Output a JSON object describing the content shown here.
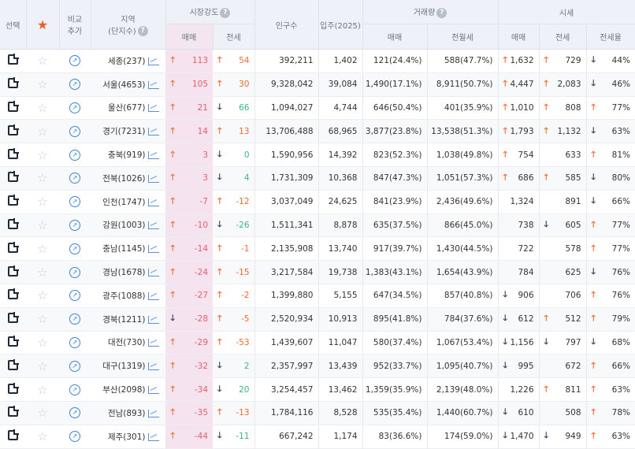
{
  "headers": {
    "select": "선택",
    "compare_line1": "비교",
    "compare_line2": "추가",
    "region_line1": "지역",
    "region_line2": "(단지수)",
    "market_strength": "시장강도",
    "population": "인구수",
    "move_in": "입주(2025)",
    "trade_volume": "거래량",
    "price": "시세",
    "sale": "매매",
    "jeonse": "전세",
    "sale2": "매매",
    "jeonse_monthly": "전월세",
    "sale3": "매매",
    "jeonse3": "전세",
    "jeonse_ratio": "전세율"
  },
  "colors": {
    "up": "#f36a2b",
    "down": "#2b3a55",
    "pink": "#e35d6a",
    "highlight": "#f5e4f0"
  },
  "rows": [
    {
      "region": "세종(237)",
      "ms_sale_dir": "up",
      "ms_sale": "113",
      "ms_j_dir": "up",
      "ms_j": "54",
      "pop": "392,211",
      "movein": "1,402",
      "vol_sale": "121(24.4%)",
      "vol_rent": "588(47.7%)",
      "p_sale_dir": "up",
      "p_sale": "1,632",
      "p_j_dir": "up",
      "p_j": "729",
      "ratio_dir": "down",
      "ratio": "44%"
    },
    {
      "region": "서울(4653)",
      "ms_sale_dir": "up",
      "ms_sale": "105",
      "ms_j_dir": "up",
      "ms_j": "30",
      "pop": "9,328,042",
      "movein": "39,084",
      "vol_sale": "1,490(17.1%)",
      "vol_rent": "8,911(50.7%)",
      "p_sale_dir": "up",
      "p_sale": "4,447",
      "p_j_dir": "up",
      "p_j": "2,083",
      "ratio_dir": "down",
      "ratio": "46%"
    },
    {
      "region": "울산(677)",
      "ms_sale_dir": "up",
      "ms_sale": "21",
      "ms_j_dir": "down",
      "ms_j": "66",
      "pop": "1,094,027",
      "movein": "4,744",
      "vol_sale": "646(50.4%)",
      "vol_rent": "401(35.9%)",
      "p_sale_dir": "up",
      "p_sale": "1,010",
      "p_j_dir": "up",
      "p_j": "808",
      "ratio_dir": "up",
      "ratio": "77%"
    },
    {
      "region": "경기(7231)",
      "ms_sale_dir": "up",
      "ms_sale": "14",
      "ms_j_dir": "up",
      "ms_j": "13",
      "pop": "13,706,488",
      "movein": "68,965",
      "vol_sale": "3,877(23.8%)",
      "vol_rent": "13,538(51.3%)",
      "p_sale_dir": "up",
      "p_sale": "1,793",
      "p_j_dir": "up",
      "p_j": "1,132",
      "ratio_dir": "down",
      "ratio": "63%"
    },
    {
      "region": "충북(919)",
      "ms_sale_dir": "up",
      "ms_sale": "3",
      "ms_j_dir": "down",
      "ms_j": "0",
      "pop": "1,590,956",
      "movein": "14,392",
      "vol_sale": "823(52.3%)",
      "vol_rent": "1,038(49.8%)",
      "p_sale_dir": "up",
      "p_sale": "754",
      "p_j_dir": "",
      "p_j": "633",
      "ratio_dir": "up",
      "ratio": "81%"
    },
    {
      "region": "전북(1026)",
      "ms_sale_dir": "up",
      "ms_sale": "3",
      "ms_j_dir": "down",
      "ms_j": "4",
      "pop": "1,731,309",
      "movein": "10,368",
      "vol_sale": "847(47.3%)",
      "vol_rent": "1,051(57.3%)",
      "p_sale_dir": "up",
      "p_sale": "686",
      "p_j_dir": "up",
      "p_j": "585",
      "ratio_dir": "down",
      "ratio": "80%"
    },
    {
      "region": "인천(1747)",
      "ms_sale_dir": "up",
      "ms_sale": "-7",
      "ms_j_dir": "up",
      "ms_j": "-12",
      "pop": "3,037,049",
      "movein": "24,625",
      "vol_sale": "841(23.9%)",
      "vol_rent": "2,436(49.6%)",
      "p_sale_dir": "",
      "p_sale": "1,324",
      "p_j_dir": "",
      "p_j": "891",
      "ratio_dir": "down",
      "ratio": "66%"
    },
    {
      "region": "강원(1003)",
      "ms_sale_dir": "up",
      "ms_sale": "-10",
      "ms_j_dir": "down",
      "ms_j": "-26",
      "pop": "1,511,341",
      "movein": "8,878",
      "vol_sale": "635(37.5%)",
      "vol_rent": "866(45.0%)",
      "p_sale_dir": "",
      "p_sale": "738",
      "p_j_dir": "down",
      "p_j": "605",
      "ratio_dir": "up",
      "ratio": "77%"
    },
    {
      "region": "충남(1145)",
      "ms_sale_dir": "up",
      "ms_sale": "-14",
      "ms_j_dir": "up",
      "ms_j": "-1",
      "pop": "2,135,908",
      "movein": "13,740",
      "vol_sale": "917(39.7%)",
      "vol_rent": "1,430(44.5%)",
      "p_sale_dir": "",
      "p_sale": "722",
      "p_j_dir": "",
      "p_j": "578",
      "ratio_dir": "up",
      "ratio": "77%"
    },
    {
      "region": "경남(1678)",
      "ms_sale_dir": "up",
      "ms_sale": "-24",
      "ms_j_dir": "up",
      "ms_j": "-15",
      "pop": "3,217,584",
      "movein": "19,738",
      "vol_sale": "1,383(43.1%)",
      "vol_rent": "1,654(43.9%)",
      "p_sale_dir": "",
      "p_sale": "784",
      "p_j_dir": "",
      "p_j": "625",
      "ratio_dir": "down",
      "ratio": "76%"
    },
    {
      "region": "광주(1088)",
      "ms_sale_dir": "up",
      "ms_sale": "-27",
      "ms_j_dir": "up",
      "ms_j": "-2",
      "pop": "1,399,880",
      "movein": "5,155",
      "vol_sale": "647(34.5%)",
      "vol_rent": "857(40.8%)",
      "p_sale_dir": "down",
      "p_sale": "906",
      "p_j_dir": "",
      "p_j": "706",
      "ratio_dir": "up",
      "ratio": "76%"
    },
    {
      "region": "경북(1211)",
      "ms_sale_dir": "down",
      "ms_sale": "-28",
      "ms_j_dir": "up",
      "ms_j": "-5",
      "pop": "2,520,934",
      "movein": "10,913",
      "vol_sale": "895(41.8%)",
      "vol_rent": "784(37.6%)",
      "p_sale_dir": "down",
      "p_sale": "612",
      "p_j_dir": "up",
      "p_j": "512",
      "ratio_dir": "up",
      "ratio": "79%"
    },
    {
      "region": "대전(730)",
      "ms_sale_dir": "up",
      "ms_sale": "-29",
      "ms_j_dir": "up",
      "ms_j": "-53",
      "pop": "1,439,607",
      "movein": "11,047",
      "vol_sale": "580(37.4%)",
      "vol_rent": "1,067(53.4%)",
      "p_sale_dir": "down",
      "p_sale": "1,156",
      "p_j_dir": "down",
      "p_j": "797",
      "ratio_dir": "down",
      "ratio": "68%"
    },
    {
      "region": "대구(1319)",
      "ms_sale_dir": "up",
      "ms_sale": "-32",
      "ms_j_dir": "down",
      "ms_j": "2",
      "pop": "2,357,997",
      "movein": "13,439",
      "vol_sale": "952(33.7%)",
      "vol_rent": "1,095(40.7%)",
      "p_sale_dir": "down",
      "p_sale": "995",
      "p_j_dir": "",
      "p_j": "672",
      "ratio_dir": "up",
      "ratio": "66%"
    },
    {
      "region": "부산(2098)",
      "ms_sale_dir": "up",
      "ms_sale": "-34",
      "ms_j_dir": "down",
      "ms_j": "20",
      "pop": "3,254,457",
      "movein": "13,462",
      "vol_sale": "1,359(35.9%)",
      "vol_rent": "2,139(48.0%)",
      "p_sale_dir": "",
      "p_sale": "1,226",
      "p_j_dir": "up",
      "p_j": "811",
      "ratio_dir": "up",
      "ratio": "63%"
    },
    {
      "region": "전남(893)",
      "ms_sale_dir": "up",
      "ms_sale": "-35",
      "ms_j_dir": "up",
      "ms_j": "-13",
      "pop": "1,784,116",
      "movein": "8,528",
      "vol_sale": "535(35.4%)",
      "vol_rent": "1,440(60.7%)",
      "p_sale_dir": "down",
      "p_sale": "610",
      "p_j_dir": "",
      "p_j": "508",
      "ratio_dir": "up",
      "ratio": "78%"
    },
    {
      "region": "제주(301)",
      "ms_sale_dir": "up",
      "ms_sale": "-44",
      "ms_j_dir": "down",
      "ms_j": "-11",
      "pop": "667,242",
      "movein": "1,174",
      "vol_sale": "83(36.6%)",
      "vol_rent": "174(59.0%)",
      "p_sale_dir": "down",
      "p_sale": "1,470",
      "p_j_dir": "down",
      "p_j": "949",
      "ratio_dir": "up",
      "ratio": "63%"
    }
  ]
}
